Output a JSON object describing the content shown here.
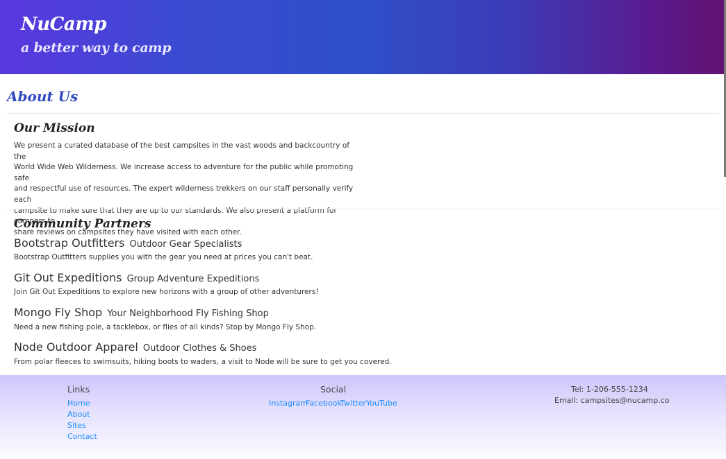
{
  "header": {
    "brand": "NuCamp",
    "tagline": "a better way to camp"
  },
  "main": {
    "title": "About Us",
    "mission": {
      "heading": "Our Mission",
      "lines": [
        "We present a curated database of the best campsites in the vast woods and backcountry of the",
        "World Wide Web Wilderness. We increase access to adventure for the public while promoting safe",
        "and respectful use of resources. The expert wilderness trekkers on our staff personally verify each",
        "campsite to make sure that they are up to our standards. We also present a platform for campers to",
        "share reviews on campsites they have visited with each other."
      ]
    },
    "partners": {
      "heading": "Community Partners",
      "items": [
        {
          "name": "Bootstrap Outfitters",
          "tag": "Outdoor Gear Specialists",
          "desc": "Bootstrap Outfitters supplies you with the gear you need at prices you can't beat."
        },
        {
          "name": "Git Out Expeditions",
          "tag": "Group Adventure Expeditions",
          "desc": "Join Git Out Expeditions to explore new horizons with a group of other adventurers!"
        },
        {
          "name": "Mongo Fly Shop",
          "tag": "Your Neighborhood Fly Fishing Shop",
          "desc": "Need a new fishing pole, a tacklebox, or flies of all kinds? Stop by Mongo Fly Shop."
        },
        {
          "name": "Node Outdoor Apparel",
          "tag": "Outdoor Clothes & Shoes",
          "desc": "From polar fleeces to swimsuits, hiking boots to waders, a visit to Node will be sure to get you covered."
        }
      ]
    }
  },
  "footer": {
    "links_title": "Links",
    "links": [
      "Home",
      "About",
      "Sites",
      "Contact"
    ],
    "social_title": "Social",
    "social": [
      "Instagram",
      "Facebook",
      "Twitter",
      "YouTube"
    ],
    "phone": "Tel: 1-206-555-1234",
    "email": "Email: campsites@nucamp.co"
  }
}
